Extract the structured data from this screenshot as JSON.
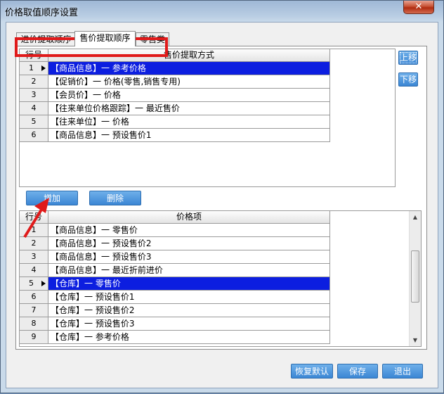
{
  "window": {
    "title": "价格取值顺序设置",
    "close_label": "✕"
  },
  "tabs": [
    {
      "label": "进价提取顺序"
    },
    {
      "label": "售价提取顺序"
    },
    {
      "label": "零售类"
    }
  ],
  "top_grid": {
    "headers": [
      "行号",
      "售价提取方式"
    ],
    "rows": [
      {
        "no": "1",
        "text": "【商品信息】一 参考价格"
      },
      {
        "no": "2",
        "text": "【促销价】一 价格(零售,销售专用)"
      },
      {
        "no": "3",
        "text": "【会员价】一 价格"
      },
      {
        "no": "4",
        "text": "【往来单位价格跟踪】一 最近售价"
      },
      {
        "no": "5",
        "text": "【往来单位】一 价格"
      },
      {
        "no": "6",
        "text": "【商品信息】一 预设售价1"
      }
    ],
    "selected_row": 1
  },
  "side_buttons": {
    "up": "上移",
    "down": "下移"
  },
  "mid_buttons": {
    "add": "增加",
    "delete": "删除"
  },
  "bottom_grid": {
    "headers": [
      "行号",
      "价格项"
    ],
    "rows": [
      {
        "no": "1",
        "text": "【商品信息】一 零售价"
      },
      {
        "no": "2",
        "text": "【商品信息】一 预设售价2"
      },
      {
        "no": "3",
        "text": "【商品信息】一 预设售价3"
      },
      {
        "no": "4",
        "text": "【商品信息】一 最近折前进价"
      },
      {
        "no": "5",
        "text": "【仓库】一 零售价"
      },
      {
        "no": "6",
        "text": "【仓库】一 预设售价1"
      },
      {
        "no": "7",
        "text": "【仓库】一 预设售价2"
      },
      {
        "no": "8",
        "text": "【仓库】一 预设售价3"
      },
      {
        "no": "9",
        "text": "【仓库】一 参考价格"
      }
    ],
    "selected_row": 5
  },
  "footer_buttons": {
    "restore": "恢复默认",
    "save": "保存",
    "exit": "退出"
  },
  "colors": {
    "selection": "#0c1ee0",
    "button": "#4a93dc",
    "annotation": "#e01a1a"
  }
}
